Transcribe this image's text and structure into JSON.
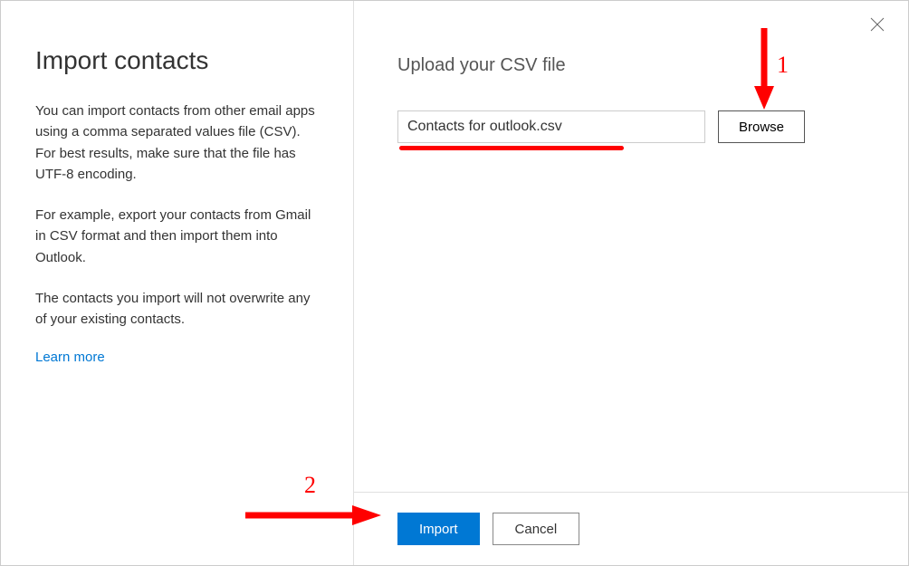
{
  "sidebar": {
    "title": "Import contacts",
    "paragraph1": "You can import contacts from other email apps using a comma separated values file (CSV). For best results, make sure that the file has UTF-8 encoding.",
    "paragraph2": "For example, export your contacts from Gmail in CSV format and then import them into Outlook.",
    "paragraph3": "The contacts you import will not overwrite any of your existing contacts.",
    "learnMore": "Learn more"
  },
  "main": {
    "uploadLabel": "Upload your CSV file",
    "fileValue": "Contacts for outlook.csv",
    "browseLabel": "Browse"
  },
  "footer": {
    "importLabel": "Import",
    "cancelLabel": "Cancel"
  },
  "annotations": {
    "label1": "1",
    "label2": "2"
  }
}
